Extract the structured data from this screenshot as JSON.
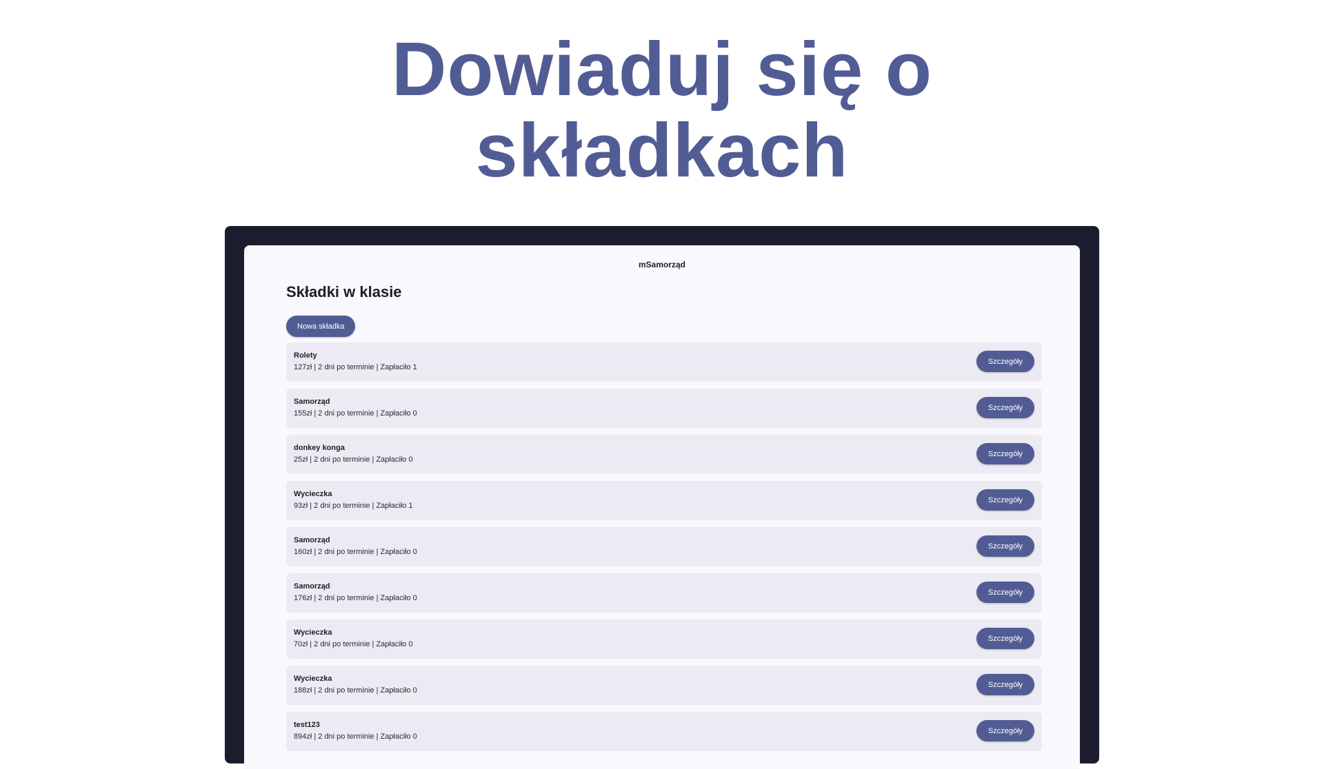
{
  "hero": {
    "line1": "Dowiaduj się o",
    "line2": "składkach"
  },
  "app": {
    "title": "mSamorząd"
  },
  "page": {
    "title": "Składki w klasie",
    "new_button_label": "Nowa składka"
  },
  "items": [
    {
      "name": "Rolety",
      "meta": "127zł | 2 dni po terminie | Zapłaciło 1",
      "button": "Szczegóły"
    },
    {
      "name": "Samorząd",
      "meta": "155zł | 2 dni po terminie | Zapłaciło 0",
      "button": "Szczegóły"
    },
    {
      "name": "donkey konga",
      "meta": "25zł | 2 dni po terminie | Zapłaciło 0",
      "button": "Szczegóły"
    },
    {
      "name": "Wycieczka",
      "meta": "93zł | 2 dni po terminie | Zapłaciło 1",
      "button": "Szczegóły"
    },
    {
      "name": "Samorząd",
      "meta": "160zł | 2 dni po terminie | Zapłaciło 0",
      "button": "Szczegóły"
    },
    {
      "name": "Samorząd",
      "meta": "176zł | 2 dni po terminie | Zapłaciło 0",
      "button": "Szczegóły"
    },
    {
      "name": "Wycieczka",
      "meta": "70zł | 2 dni po terminie | Zapłaciło 0",
      "button": "Szczegóły"
    },
    {
      "name": "Wycieczka",
      "meta": "188zł | 2 dni po terminie | Zapłaciło 0",
      "button": "Szczegóły"
    },
    {
      "name": "test123",
      "meta": "894zł | 2 dni po terminie | Zapłaciło 0",
      "button": "Szczegóły"
    }
  ],
  "colors": {
    "accent": "#525c94",
    "device_frame": "#1b1d2f",
    "screen_bg": "#f9f8fc",
    "row_bg": "#ecebf3"
  }
}
